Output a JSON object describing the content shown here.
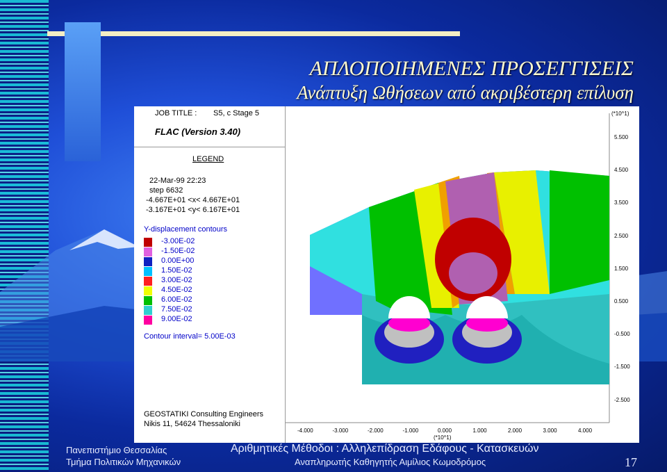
{
  "slide": {
    "title": "ΑΠΛΟΠΟΙΗΜΕΝΕΣ ΠΡΟΣΕΓΓΙΣΕΙΣ",
    "subtitle": "Ανάπτυξη Ωθήσεων από ακριβέστερη επίλυση",
    "footer_left_1": "Πανεπιστήμιο Θεσσαλίας",
    "footer_left_2": "Τμήμα Πολιτικών Μηχανικών",
    "footer_center_1": "Αριθμητικές Μέθοδοι : Αλληλεπίδραση Εδάφους - Κατασκευών",
    "footer_center_2": "Αναπληρωτής Καθηγητής Αιμίλιος Κωμοδρόμος",
    "page_number": "17"
  },
  "legend": {
    "job_label": "JOB TITLE :",
    "job_value": "S5, c Stage 5",
    "program": "FLAC (Version 3.40)",
    "legend_title": "LEGEND",
    "date": "22-Mar-99  22:23",
    "step": "step     6632",
    "x_range": "-4.667E+01 <x<  4.667E+01",
    "y_range": "-3.167E+01 <y<  6.167E+01",
    "contour_title": "Y-displacement contours",
    "contour_values": [
      "-3.00E-02",
      "-1.50E-02",
      "0.00E+00",
      "1.50E-02",
      "3.00E-02",
      "4.50E-02",
      "6.00E-02",
      "7.50E-02",
      "9.00E-02"
    ],
    "contour_colors": [
      "#c00000",
      "#e060e0",
      "#1020c0",
      "#00c0ff",
      "#ff2020",
      "#f0ff00",
      "#00c000",
      "#30d0d0",
      "#ff00a0"
    ],
    "contour_interval": "Contour interval=  5.00E-03",
    "company": "GEOSTATIKI Consulting Engineers",
    "address": "Nikis 11, 54624 Thessaloniki"
  },
  "plot": {
    "y_scale_label": "(*10^1)",
    "x_scale_label": "(*10^1)",
    "y_ticks": [
      "5.500",
      "4.500",
      "3.500",
      "2.500",
      "1.500",
      "0.500",
      "-0.500",
      "-1.500",
      "-2.500"
    ],
    "x_ticks": [
      "-4.000",
      "-3.000",
      "-2.000",
      "-1.000",
      "0.000",
      "1.000",
      "2.000",
      "3.000",
      "4.000"
    ]
  }
}
